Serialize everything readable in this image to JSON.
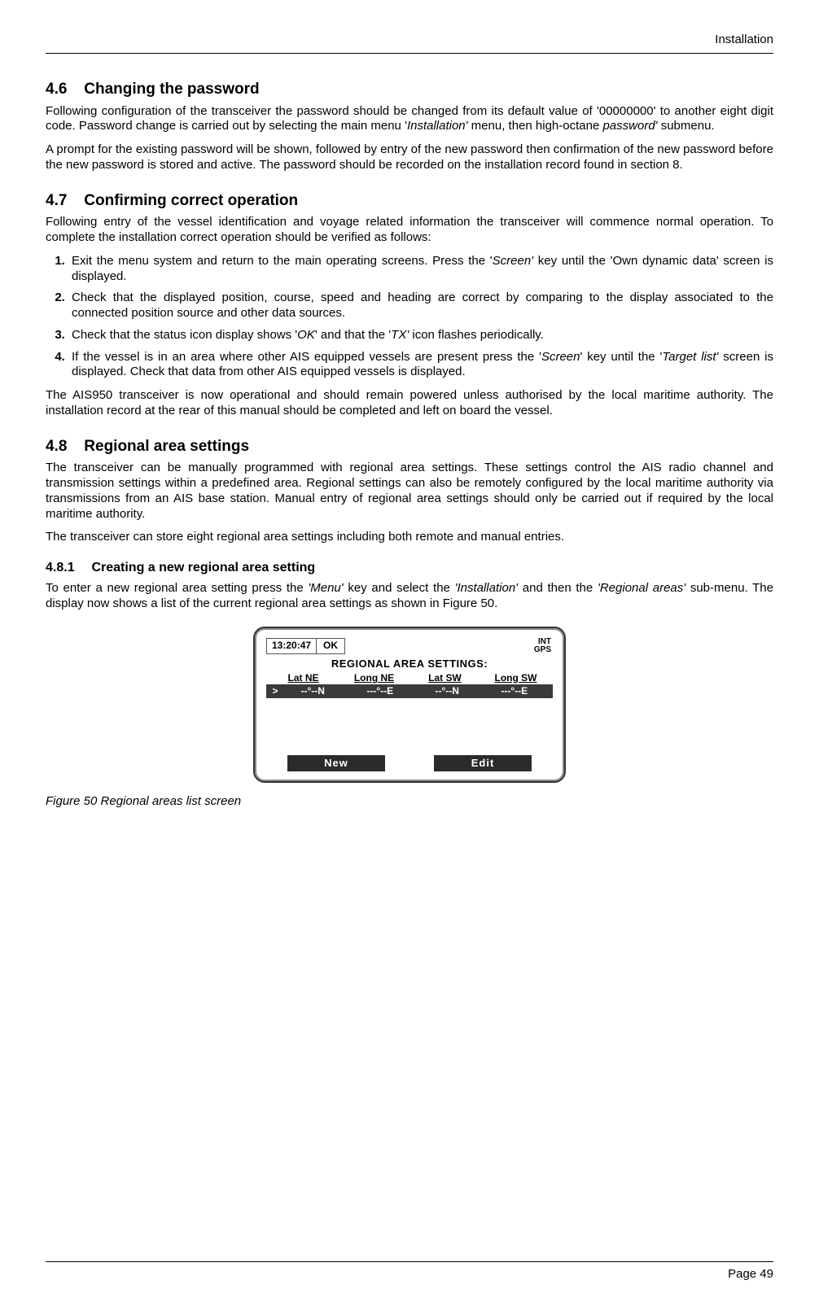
{
  "header": {
    "section": "Installation"
  },
  "s46": {
    "num": "4.6",
    "title": "Changing the password",
    "p1": "Following configuration of the transceiver the password should be changed from its default value of '00000000' to another eight digit code. Password change is carried out by selecting the main menu '",
    "p1_i1": "Installation'",
    "p1_b": " menu, then high-octane ",
    "p1_i2": "password'",
    "p1_c": " submenu.",
    "p2": "A prompt for the existing password will be shown, followed by entry of the new password then confirmation of the new password before the new password is stored and active. The password should be recorded on the installation record found in section 8."
  },
  "s47": {
    "num": "4.7",
    "title": "Confirming correct operation",
    "intro": "Following entry of the vessel identification and voyage related information the transceiver will commence normal operation. To complete the installation correct operation should be verified as follows:",
    "steps": [
      {
        "a": "Exit the menu system and return to the main operating screens. Press the '",
        "i1": "Screen'",
        "b": " key until the 'Own dynamic data' screen is displayed."
      },
      {
        "a": "Check that the displayed position, course, speed and heading are correct by comparing to the display associated to the connected position source and other data sources."
      },
      {
        "a": "Check that the status icon display shows '",
        "i1": "OK",
        "b": "' and that the '",
        "i2": "TX'",
        "c": " icon flashes periodically."
      },
      {
        "a": "If the vessel is in an area where other AIS equipped vessels are present press the '",
        "i1": "Screen",
        "b": "' key until the '",
        "i2": "Target list'",
        "c": " screen is displayed. Check that data from other AIS equipped vessels is displayed."
      }
    ],
    "out": "The AIS950 transceiver is now operational and should remain powered unless authorised by the local maritime authority. The installation record at the rear of this manual should be completed and left on board the vessel."
  },
  "s48": {
    "num": "4.8",
    "title": "Regional area settings",
    "p1": "The transceiver can be manually programmed with regional area settings. These settings control the AIS radio channel and transmission settings within a predefined area. Regional settings can also be remotely configured by the local maritime authority via transmissions from an AIS base station. Manual entry of regional area settings should only be carried out if required by the local maritime authority.",
    "p2": "The transceiver can store eight regional area settings including both remote and manual entries."
  },
  "s481": {
    "num": "4.8.1",
    "title": "Creating a new regional area setting",
    "p1a": "To enter a new regional area setting press the ",
    "p1i1": "'Menu'",
    "p1b": " key and select the ",
    "p1i2": "'Installation'",
    "p1c": " and then the ",
    "p1i3": "'Regional areas'",
    "p1d": " sub-menu. The display now shows a list of the current regional area settings as shown in Figure 50."
  },
  "fig50": {
    "time": "13:20:47",
    "status": "OK",
    "ind1": "INT",
    "ind2": "GPS",
    "title": "REGIONAL AREA SETTINGS:",
    "headers": [
      "Lat NE",
      "Long NE",
      "Lat SW",
      "Long SW"
    ],
    "row": {
      "caret": ">",
      "c1": "--°--N",
      "c2": "---°--E",
      "c3": "--°--N",
      "c4": "---°--E"
    },
    "soft_new": "New",
    "soft_edit": "Edit",
    "caption": "Figure 50    Regional areas list screen"
  },
  "footer": {
    "page": "Page 49"
  }
}
